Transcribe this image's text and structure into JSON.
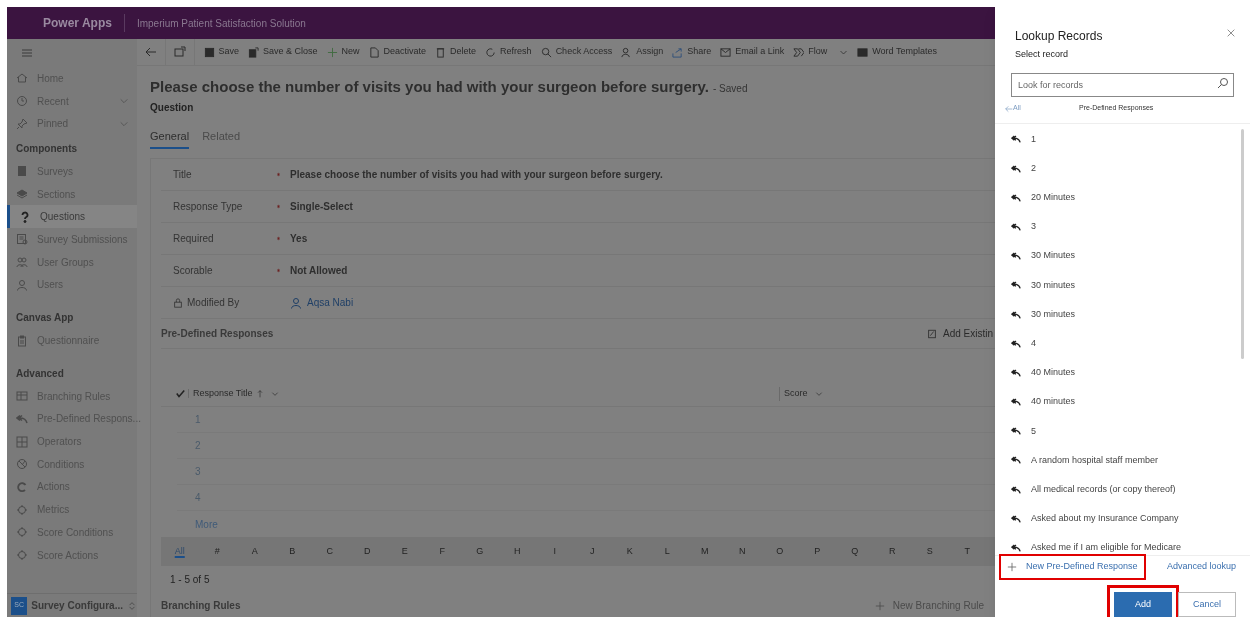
{
  "top_bar": {
    "app_name": "Power Apps",
    "solution": "Imperium Patient Satisfaction Solution"
  },
  "sidebar": {
    "sections": [
      {
        "items": [
          {
            "label": "Home",
            "selected": false,
            "expandable": false
          },
          {
            "label": "Recent",
            "selected": false,
            "expandable": true
          },
          {
            "label": "Pinned",
            "selected": false,
            "expandable": true
          }
        ]
      },
      {
        "heading": "Components",
        "items": [
          {
            "label": "Surveys",
            "selected": false,
            "expandable": false
          },
          {
            "label": "Sections",
            "selected": false,
            "expandable": false
          },
          {
            "label": "Questions",
            "selected": true,
            "expandable": false
          },
          {
            "label": "Survey Submissions",
            "selected": false,
            "expandable": false
          },
          {
            "label": "User Groups",
            "selected": false,
            "expandable": false
          },
          {
            "label": "Users",
            "selected": false,
            "expandable": false
          }
        ]
      },
      {
        "heading": "Canvas App",
        "items": [
          {
            "label": "Questionnaire",
            "selected": false,
            "expandable": false
          }
        ]
      },
      {
        "heading": "Advanced",
        "items": [
          {
            "label": "Branching Rules",
            "selected": false,
            "expandable": false
          },
          {
            "label": "Pre-Defined Respons...",
            "selected": false,
            "expandable": false
          },
          {
            "label": "Operators",
            "selected": false,
            "expandable": false
          },
          {
            "label": "Conditions",
            "selected": false,
            "expandable": false
          },
          {
            "label": "Actions",
            "selected": false,
            "expandable": false
          },
          {
            "label": "Metrics",
            "selected": false,
            "expandable": false
          },
          {
            "label": "Score Conditions",
            "selected": false,
            "expandable": false
          },
          {
            "label": "Score Actions",
            "selected": false,
            "expandable": false
          }
        ]
      }
    ],
    "environment": {
      "initials": "SC",
      "label": "Survey Configura..."
    }
  },
  "toolbar": [
    {
      "label": "Save",
      "dropdown": false
    },
    {
      "label": "Save & Close",
      "dropdown": false
    },
    {
      "label": "New",
      "dropdown": false
    },
    {
      "label": "Deactivate",
      "dropdown": false
    },
    {
      "label": "Delete",
      "dropdown": false
    },
    {
      "label": "Refresh",
      "dropdown": false
    },
    {
      "label": "Check Access",
      "dropdown": false
    },
    {
      "label": "Assign",
      "dropdown": false
    },
    {
      "label": "Share",
      "dropdown": false
    },
    {
      "label": "Email a Link",
      "dropdown": false
    },
    {
      "label": "Flow",
      "dropdown": true
    },
    {
      "label": "Word Templates",
      "dropdown": false
    }
  ],
  "record": {
    "title": "Please choose the number of visits you had with your surgeon before surgery.",
    "status": "- Saved",
    "entity": "Question"
  },
  "tabs": [
    {
      "label": "General",
      "selected": true
    },
    {
      "label": "Related",
      "selected": false
    }
  ],
  "fields": [
    {
      "label": "Title",
      "required": true,
      "locked": false,
      "kind": "text",
      "value": "Please choose the number of visits you had with your surgeon before surgery."
    },
    {
      "label": "Response Type",
      "required": true,
      "locked": false,
      "kind": "text",
      "value": "Single-Select"
    },
    {
      "label": "Required",
      "required": true,
      "locked": false,
      "kind": "text",
      "value": "Yes"
    },
    {
      "label": "Scorable",
      "required": true,
      "locked": false,
      "kind": "text",
      "value": "Not Allowed"
    },
    {
      "label": "Modified By",
      "required": false,
      "locked": true,
      "kind": "lookup",
      "value": "Aqsa Nabi"
    }
  ],
  "subgrid": {
    "title": "Pre-Defined Responses",
    "command": "Add Existin",
    "columns": [
      {
        "label": "Response Title",
        "sorted": true
      },
      {
        "label": "Score",
        "sorted": false
      }
    ],
    "rows": [
      "1",
      "2",
      "3",
      "4"
    ],
    "more": "More",
    "alphabet": [
      {
        "label": "All",
        "selected": true
      },
      {
        "label": "#",
        "selected": false
      },
      {
        "label": "A",
        "selected": false
      },
      {
        "label": "B",
        "selected": false
      },
      {
        "label": "C",
        "selected": false
      },
      {
        "label": "D",
        "selected": false
      },
      {
        "label": "E",
        "selected": false
      },
      {
        "label": "F",
        "selected": false
      },
      {
        "label": "G",
        "selected": false
      },
      {
        "label": "H",
        "selected": false
      },
      {
        "label": "I",
        "selected": false
      },
      {
        "label": "J",
        "selected": false
      },
      {
        "label": "K",
        "selected": false
      },
      {
        "label": "L",
        "selected": false
      },
      {
        "label": "M",
        "selected": false
      },
      {
        "label": "N",
        "selected": false
      },
      {
        "label": "O",
        "selected": false
      },
      {
        "label": "P",
        "selected": false
      },
      {
        "label": "Q",
        "selected": false
      },
      {
        "label": "R",
        "selected": false
      },
      {
        "label": "S",
        "selected": false
      },
      {
        "label": "T",
        "selected": false
      }
    ],
    "count": "1 - 5 of 5"
  },
  "branching": {
    "title": "Branching Rules",
    "command": "New Branching Rule"
  },
  "lookup": {
    "title": "Lookup Records",
    "subtitle": "Select record",
    "search_placeholder": "Look for records",
    "back": "All",
    "list_title": "Pre-Defined Responses",
    "records": [
      "1",
      "2",
      "20 Minutes",
      "3",
      "30 Minutes",
      "30 minutes",
      "30 minutes",
      "4",
      "40 Minutes",
      "40 minutes",
      "5",
      "A random hospital staff member",
      "All medical records (or copy thereof)",
      "Asked about my Insurance Company",
      "Asked me if I am eligible for Medicare"
    ],
    "new_button": {
      "label": "New Pre-Defined Response",
      "highlighted": true
    },
    "advanced": "Advanced lookup",
    "buttons": [
      {
        "label": "Add",
        "kind": "primary",
        "highlighted": true
      },
      {
        "label": "Cancel",
        "kind": "secondary",
        "highlighted": false
      }
    ]
  }
}
